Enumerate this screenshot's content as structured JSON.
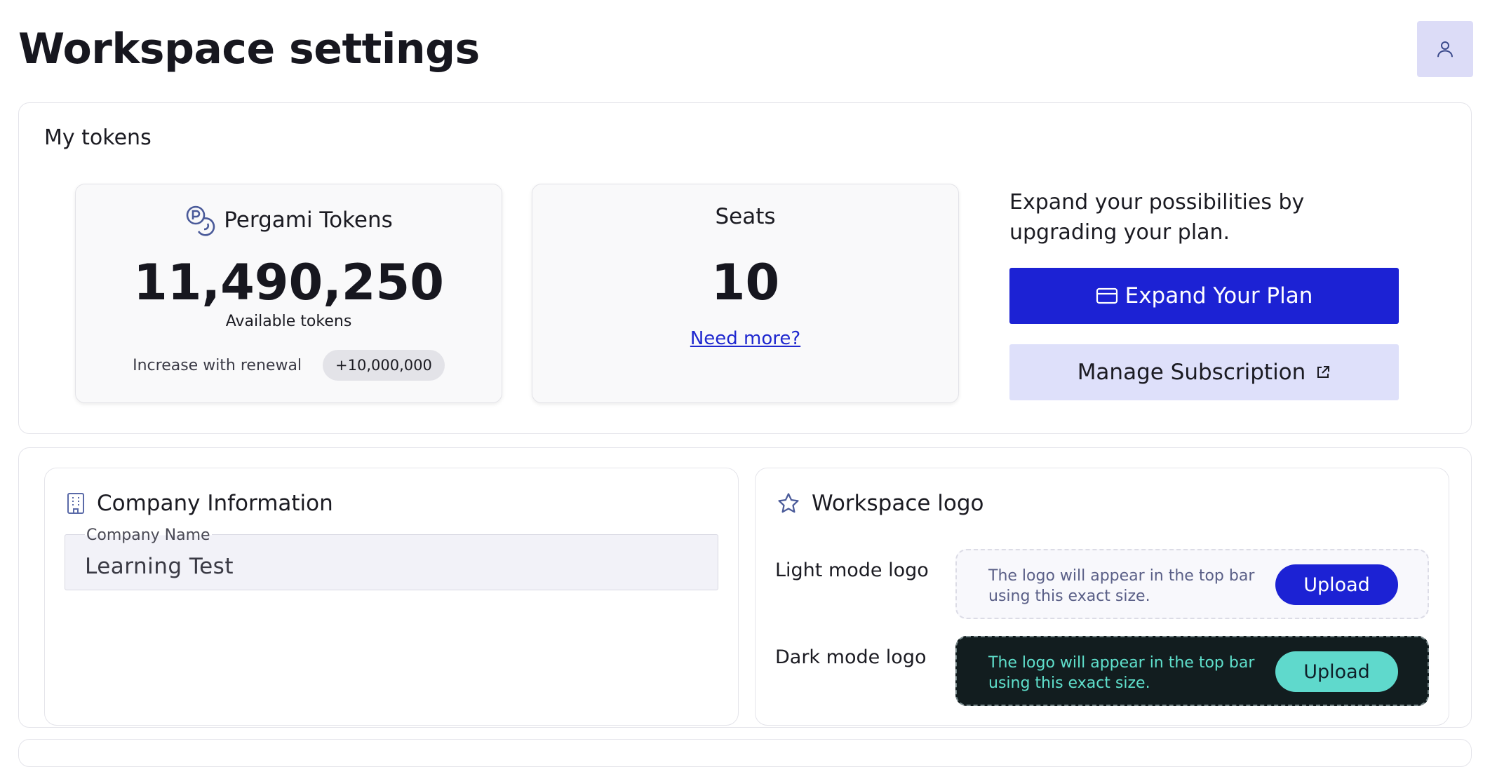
{
  "header": {
    "title": "Workspace settings",
    "user_icon": "user-icon"
  },
  "tokens_section": {
    "title": "My tokens",
    "tokens_card": {
      "icon": "pergami-token-icon",
      "label": "Pergami Tokens",
      "value": "11,490,250",
      "sub_label": "Available tokens",
      "renew_label": "Increase with renewal",
      "renew_value": "+10,000,000"
    },
    "seats_card": {
      "label": "Seats",
      "value": "10",
      "link": "Need more?"
    },
    "upsell": {
      "text": "Expand your possibilities by upgrading your plan.",
      "expand_button": "Expand Your Plan",
      "expand_icon": "credit-card-icon",
      "manage_button": "Manage Subscription",
      "manage_icon": "external-link-icon"
    }
  },
  "company_info": {
    "icon": "building-icon",
    "title": "Company Information",
    "field_label": "Company Name",
    "field_value": "Learning Test"
  },
  "workspace_logo": {
    "icon": "star-icon",
    "title": "Workspace logo",
    "light": {
      "label": "Light mode logo",
      "hint": "The logo will appear in the top bar using this exact size.",
      "button": "Upload"
    },
    "dark": {
      "label": "Dark mode logo",
      "hint": "The logo will appear in the top bar using this exact size.",
      "button": "Upload"
    }
  },
  "colors": {
    "primary": "#1c22d4",
    "primary_light": "#dee0fa",
    "accent_teal": "#5fd9cc",
    "dark_panel": "#121d1f"
  }
}
